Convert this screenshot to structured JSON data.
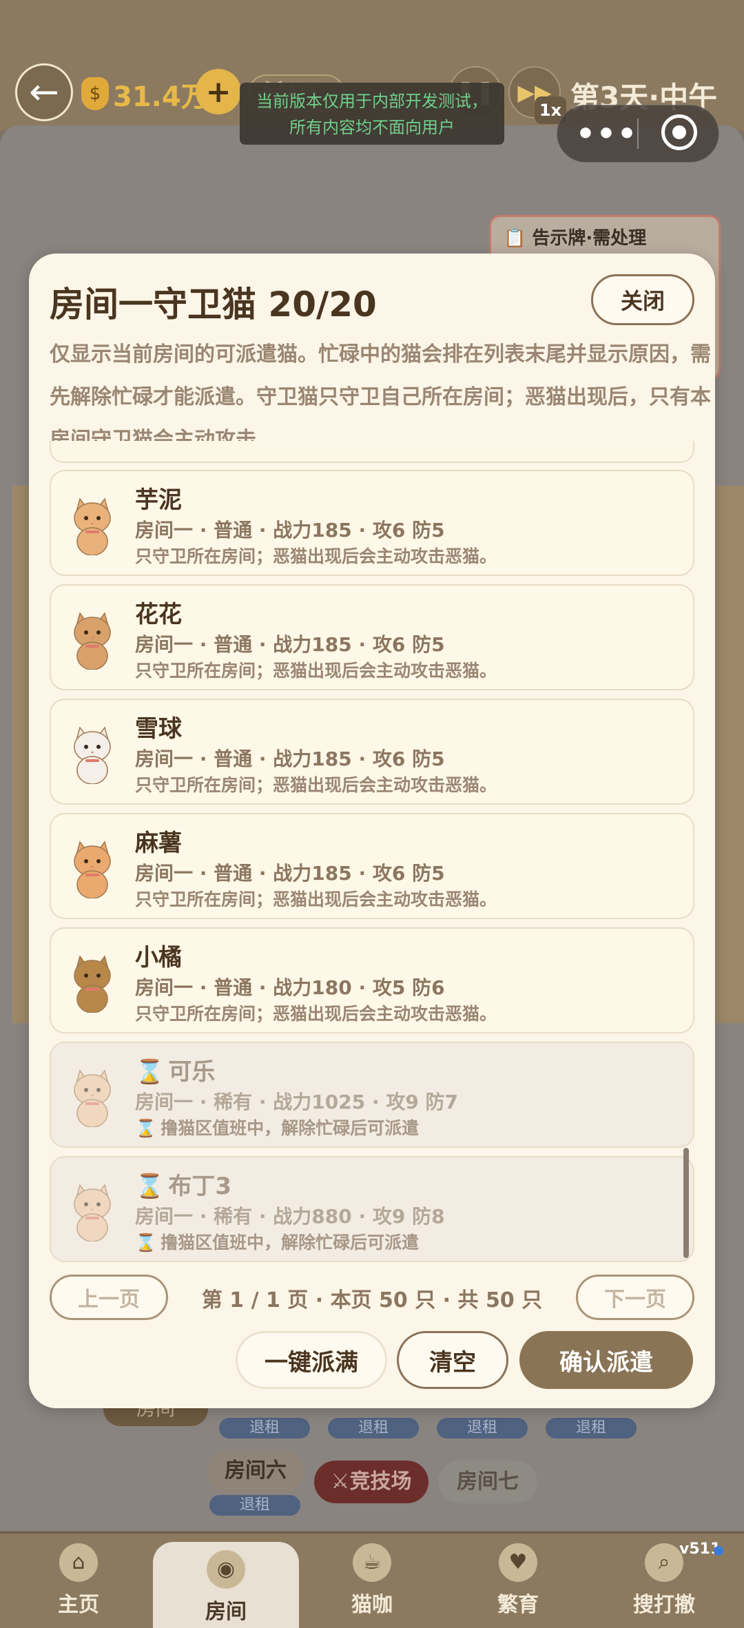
{
  "topbar": {
    "back_icon": "arrow-left-icon",
    "money": "31.4万",
    "plus": "+",
    "faint_pill": "🐱4/5",
    "speed": "1x",
    "day": "第3天·中午"
  },
  "dev_banner": {
    "line1": "当前版本仅用于内部开发测试，",
    "line2": "所有内容均不面向用户"
  },
  "notice_board": {
    "title": "📋 告示牌·需处理"
  },
  "background": {
    "room_label": "房间",
    "rent_tag": "退租",
    "room6": "房间六",
    "arena": "⚔竞技场",
    "room7": "房间七"
  },
  "modal": {
    "title": "房间一守卫猫 20/20",
    "close": "关闭",
    "description": "仅显示当前房间的可派遣猫。忙碌中的猫会排在列表末尾并显示原因，需先解除忙碌才能派遣。守卫猫只守卫自己所在房间；恶猫出现后，只有本房间守卫猫会主动攻击。",
    "cats": [
      {
        "name": "芋泥",
        "meta": "房间一 · 普通 · 战力185 · 攻6 防5",
        "hint": "只守卫所在房间；恶猫出现后会主动攻击恶猫。",
        "busy": false,
        "fur": "#e8b27a"
      },
      {
        "name": "花花",
        "meta": "房间一 · 普通 · 战力185 · 攻6 防5",
        "hint": "只守卫所在房间；恶猫出现后会主动攻击恶猫。",
        "busy": false,
        "fur": "#d9a26a"
      },
      {
        "name": "雪球",
        "meta": "房间一 · 普通 · 战力185 · 攻6 防5",
        "hint": "只守卫所在房间；恶猫出现后会主动攻击恶猫。",
        "busy": false,
        "fur": "#f4efe8"
      },
      {
        "name": "麻薯",
        "meta": "房间一 · 普通 · 战力185 · 攻6 防5",
        "hint": "只守卫所在房间；恶猫出现后会主动攻击恶猫。",
        "busy": false,
        "fur": "#eaa96e"
      },
      {
        "name": "小橘",
        "meta": "房间一 · 普通 · 战力180 · 攻5 防6",
        "hint": "只守卫所在房间；恶猫出现后会主动攻击恶猫。",
        "busy": false,
        "fur": "#b8884a"
      },
      {
        "name": "可乐",
        "meta": "房间一 · 稀有 · 战力1025 · 攻9 防7",
        "hint": "撸猫区值班中，解除忙碌后可派遣",
        "busy": true,
        "fur": "#efc9a4"
      },
      {
        "name": "布丁3",
        "meta": "房间一 · 稀有 · 战力880 · 攻9 防8",
        "hint": "撸猫区值班中，解除忙碌后可派遣",
        "busy": true,
        "fur": "#efc7a6"
      }
    ],
    "prev_page": "上一页",
    "page_info": "第 1 / 1 页 · 本页 50 只 · 共 50 只",
    "next_page": "下一页",
    "fill_all": "一键派满",
    "clear": "清空",
    "confirm": "确认派遣"
  },
  "nav": [
    {
      "label": "主页",
      "icon": "home-icon",
      "glyph": "⌂"
    },
    {
      "label": "房间",
      "icon": "room-icon",
      "glyph": "◉"
    },
    {
      "label": "猫咖",
      "icon": "cat-cafe-icon",
      "glyph": "☕"
    },
    {
      "label": "繁育",
      "icon": "breeding-icon",
      "glyph": "♥"
    },
    {
      "label": "搜打撤",
      "icon": "magnifier-icon",
      "glyph": "⌕"
    }
  ],
  "version": "v511",
  "colors": {
    "modal_bg": "#fcf6e8",
    "accent_brown": "#8a7456",
    "money_gold": "#e8b948",
    "banner_green": "#6fd08a"
  }
}
